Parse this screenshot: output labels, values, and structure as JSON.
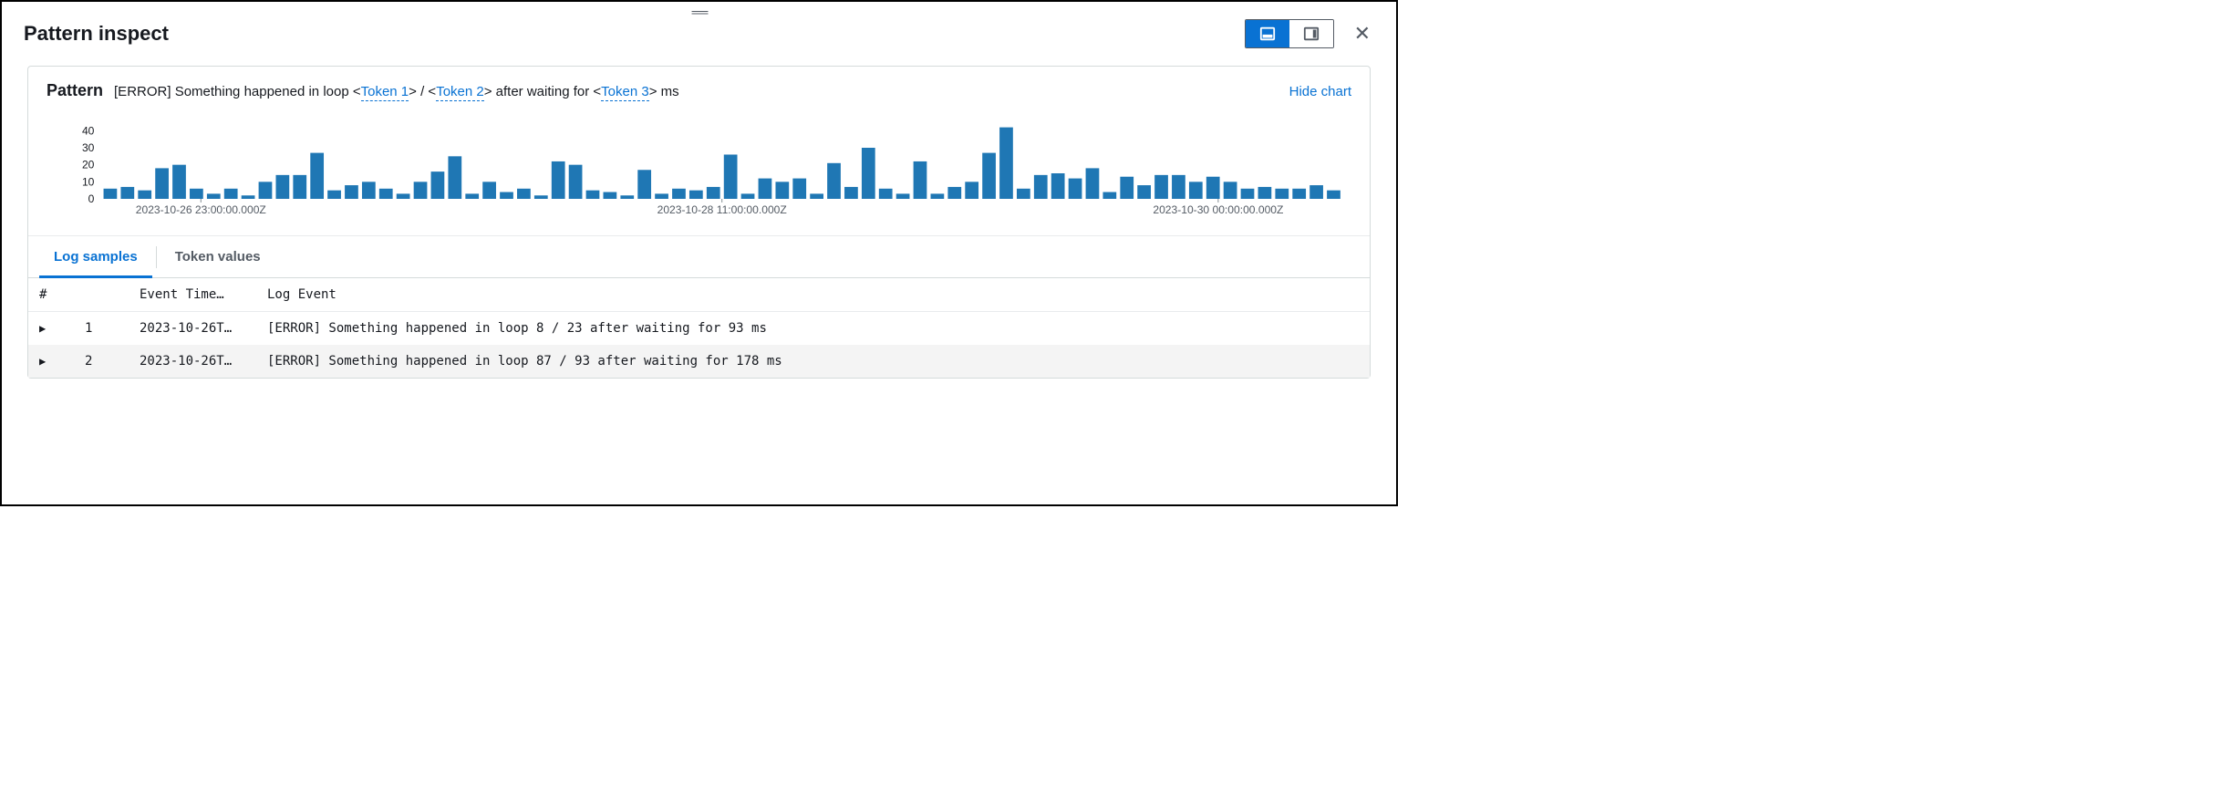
{
  "header": {
    "title": "Pattern inspect"
  },
  "card": {
    "title": "Pattern",
    "pattern_pre": "[ERROR] Something happened in loop <",
    "token1": "Token 1",
    "pattern_mid1": "> / <",
    "token2": "Token 2",
    "pattern_mid2": "> after waiting for <",
    "token3": "Token 3",
    "pattern_post": "> ms",
    "hide_chart": "Hide chart"
  },
  "tabs": {
    "log_samples": "Log samples",
    "token_values": "Token values"
  },
  "columns": {
    "hash": "#",
    "event_time": "Event Time…",
    "log_event": "Log Event"
  },
  "rows": [
    {
      "n": "1",
      "time": "2023-10-26T…",
      "event": "[ERROR] Something happened in loop 8 / 23 after waiting for 93 ms"
    },
    {
      "n": "2",
      "time": "2023-10-26T…",
      "event": "[ERROR] Something happened in loop 87 / 93 after waiting for 178 ms"
    }
  ],
  "chart_data": {
    "type": "bar",
    "title": "",
    "xlabel": "",
    "ylabel": "",
    "ylim": [
      0,
      45
    ],
    "y_ticks": [
      0,
      10,
      20,
      30,
      40
    ],
    "x_tick_labels": [
      "2023-10-26 23:00:00.000Z",
      "2023-10-28 11:00:00.000Z",
      "2023-10-30 00:00:00.000Z"
    ],
    "values": [
      6,
      7,
      5,
      18,
      20,
      6,
      3,
      6,
      2,
      10,
      14,
      14,
      27,
      5,
      8,
      10,
      6,
      3,
      10,
      16,
      25,
      3,
      10,
      4,
      6,
      2,
      22,
      20,
      5,
      4,
      2,
      17,
      3,
      6,
      5,
      7,
      26,
      3,
      12,
      10,
      12,
      3,
      21,
      7,
      30,
      6,
      3,
      22,
      3,
      7,
      10,
      27,
      42,
      6,
      14,
      15,
      12,
      18,
      4,
      13,
      8,
      14,
      14,
      10,
      13,
      10,
      6,
      7,
      6,
      6,
      8,
      5
    ]
  }
}
